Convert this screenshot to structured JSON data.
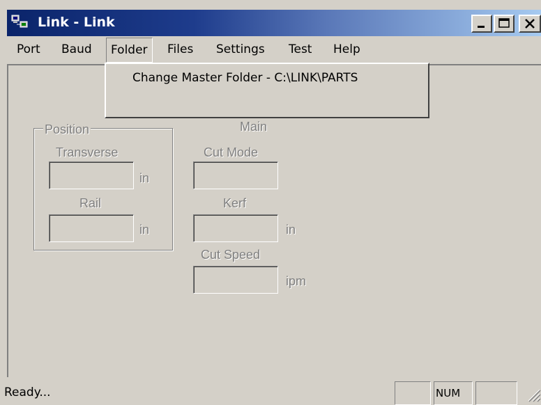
{
  "window": {
    "title": "Link - Link",
    "icon": "app-network-icon"
  },
  "caption_buttons": [
    {
      "name": "minimize",
      "icon": "minimize-icon"
    },
    {
      "name": "maximize",
      "icon": "maximize-icon"
    },
    {
      "name": "close",
      "icon": "close-icon"
    }
  ],
  "menu": {
    "items": [
      "Port",
      "Baud",
      "Folder",
      "Files",
      "Settings",
      "Test",
      "Help"
    ],
    "open_item": "Folder"
  },
  "dropdown": {
    "items": [
      "Change Master Folder - C:\\LINK\\PARTS"
    ]
  },
  "position_group": {
    "caption": "Position",
    "transverse_label": "Transverse",
    "transverse_unit": "in",
    "rail_label": "Rail",
    "rail_unit": "in"
  },
  "main_group": {
    "caption": "Main",
    "cut_mode_label": "Cut Mode",
    "kerf_label": "Kerf",
    "kerf_unit": "in",
    "cut_speed_label": "Cut Speed",
    "cut_speed_unit": "ipm"
  },
  "status": {
    "text": "Ready...",
    "num_indicator": "NUM"
  },
  "colors": {
    "face": "#d4d0c8",
    "title_start": "#0a246a",
    "title_end": "#a6caf0",
    "disabled_text": "#808080"
  }
}
